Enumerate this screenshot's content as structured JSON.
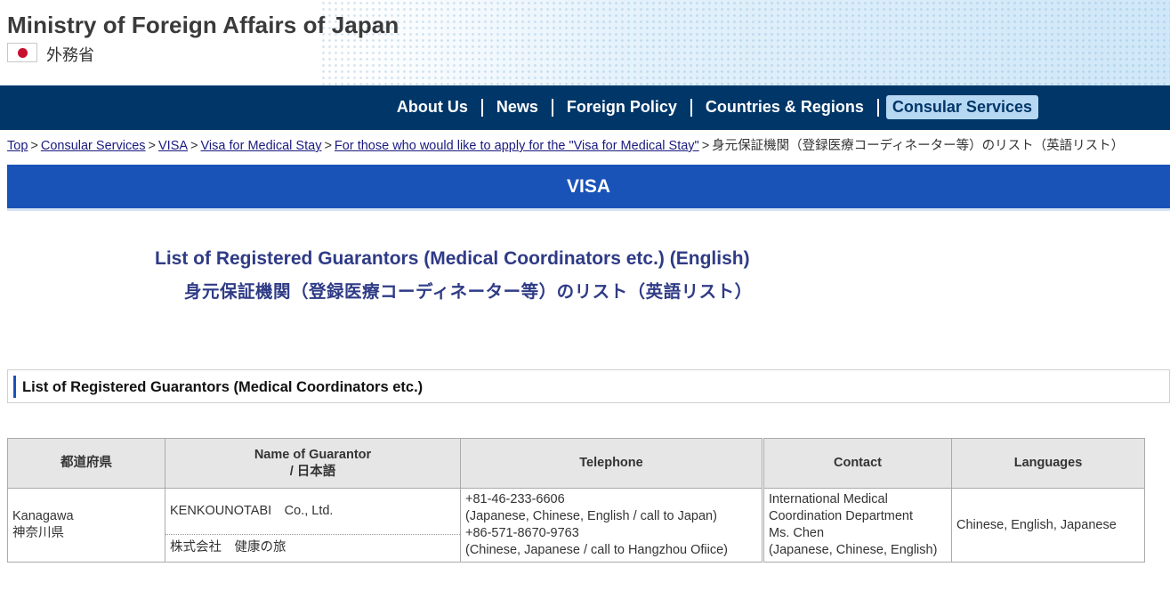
{
  "header": {
    "site_title": "Ministry of Foreign Affairs of Japan",
    "site_subtitle": "外務省"
  },
  "nav": {
    "items": [
      {
        "label": "About Us"
      },
      {
        "label": "News"
      },
      {
        "label": "Foreign Policy"
      },
      {
        "label": "Countries & Regions"
      },
      {
        "label": "Consular Services",
        "active": true
      }
    ]
  },
  "breadcrumb": {
    "links": [
      "Top",
      "Consular Services",
      "VISA",
      "Visa for Medical Stay",
      "For those who would like to apply for the \"Visa for Medical Stay\""
    ],
    "current": "身元保証機関（登録医療コーディネーター等）のリスト（英語リスト）"
  },
  "section": {
    "title": "VISA"
  },
  "page": {
    "title_en": "List of Registered Guarantors (Medical Coordinators etc.) (English)",
    "title_ja": "身元保証機関（登録医療コーディネーター等）のリスト（英語リスト）"
  },
  "subhead": {
    "title": "List of Registered Guarantors (Medical Coordinators etc.)"
  },
  "table": {
    "headers": {
      "prefecture": "都道府県",
      "name_line1": "Name of Guarantor",
      "name_line2": "/ 日本語",
      "telephone": "Telephone",
      "contact": "Contact",
      "languages": "Languages"
    },
    "rows": [
      {
        "prefecture_en": "Kanagawa",
        "prefecture_ja": "神奈川県",
        "name_en": "KENKOUNOTABI　Co., Ltd.",
        "name_ja": "株式会社　健康の旅",
        "tel": [
          "+81-46-233-6606",
          "(Japanese, Chinese, English / call to Japan)",
          "+86-571-8670-9763",
          "(Chinese, Japanese / call to Hangzhou Ofiice)"
        ],
        "contact": [
          "International Medical",
          "Coordination Department",
          "Ms. Chen",
          "(Japanese, Chinese, English)"
        ],
        "languages": "Chinese, English, Japanese"
      }
    ]
  }
}
